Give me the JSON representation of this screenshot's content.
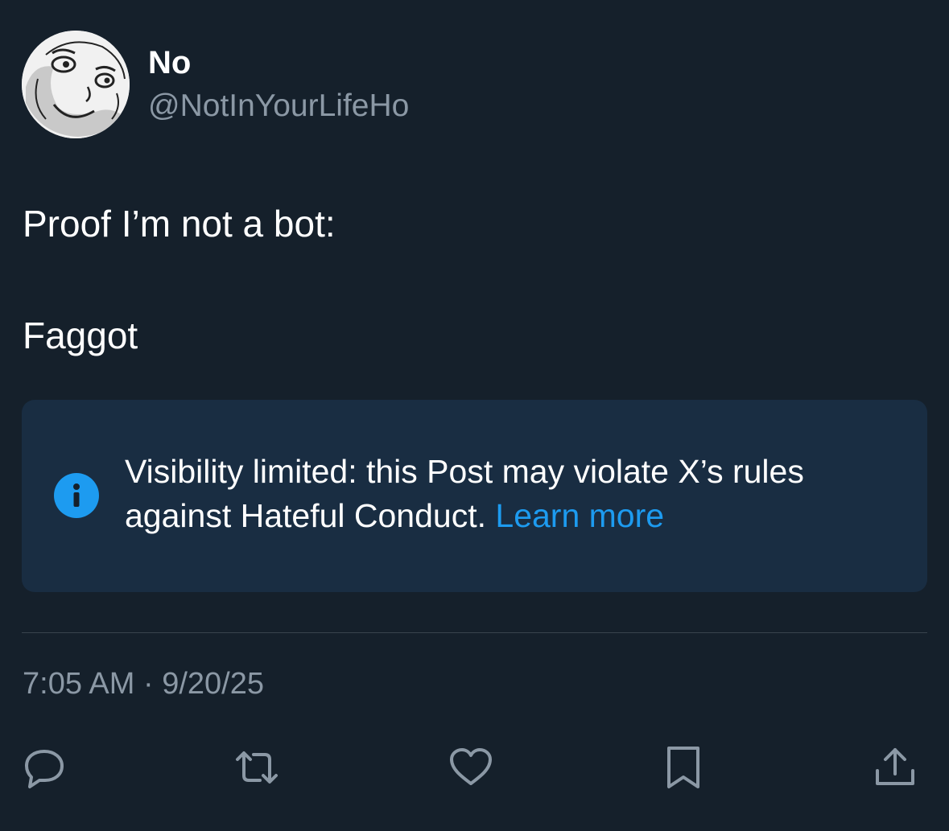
{
  "author": {
    "display_name": "No",
    "handle": "@NotInYourLifeHo",
    "avatar": "meme-face-avatar"
  },
  "post": {
    "lines": [
      "Proof I’m not a bot:",
      "Faggot"
    ]
  },
  "notice": {
    "icon": "info-icon",
    "text": "Visibility limited: this Post may violate X’s rules against Hateful Conduct. ",
    "link_label": "Learn more"
  },
  "meta": {
    "timestamp": "7:05 AM · 9/20/25"
  },
  "actions": [
    {
      "icon": "reply-icon"
    },
    {
      "icon": "repost-icon"
    },
    {
      "icon": "like-icon"
    },
    {
      "icon": "bookmark-icon"
    },
    {
      "icon": "share-icon"
    }
  ],
  "colors": {
    "background": "#15202b",
    "notice_background": "#192d42",
    "accent": "#1d9bf0",
    "secondary_text": "#8b98a5",
    "divider": "#38444d"
  }
}
